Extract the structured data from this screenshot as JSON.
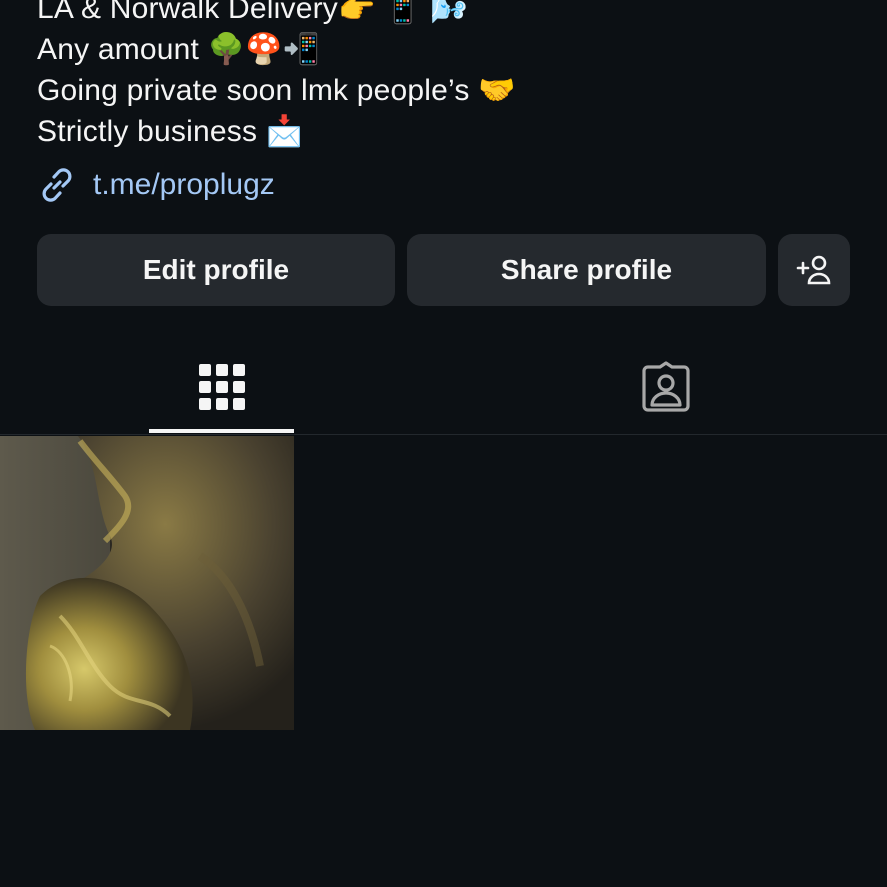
{
  "bio": {
    "lines": [
      "LA & Norwalk Delivery👉 📱 🌬️",
      "Any amount 🌳🍄📲",
      "Going private soon lmk people’s 🤝",
      "Strictly business 📩"
    ],
    "link_text": "t.me/proplugz",
    "link_color": "#a4c8f5"
  },
  "actions": {
    "edit_label": "Edit profile",
    "share_label": "Share profile",
    "add_icon": "person-add-icon"
  },
  "tabs": [
    {
      "icon": "grid-icon",
      "active": true
    },
    {
      "icon": "tagged-person-icon",
      "active": false
    }
  ],
  "posts": [
    {
      "icon": "photo-thumbnail"
    }
  ],
  "colors": {
    "background": "#0c1014",
    "button_bg": "#25292e",
    "text": "#f5f5f5"
  }
}
